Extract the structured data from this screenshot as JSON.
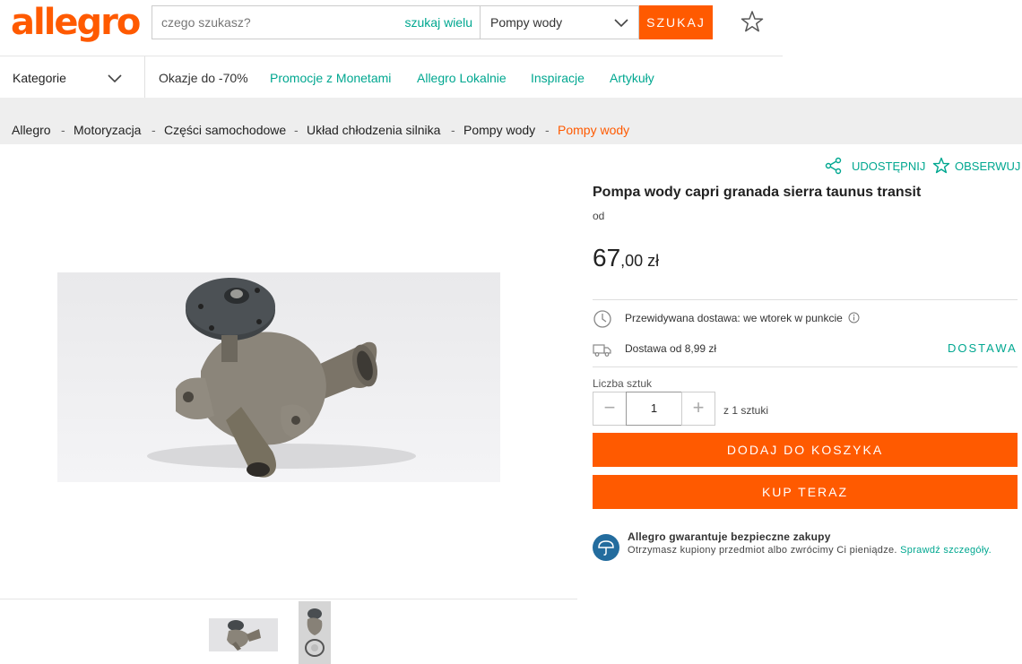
{
  "header": {
    "logo_text": "allegro",
    "search_placeholder": "czego szukasz?",
    "search_many_label": "szukaj wielu",
    "category_selected": "Pompy wody",
    "search_button": "SZUKAJ"
  },
  "nav": {
    "categories_label": "Kategorie",
    "links": [
      "Okazje do -70%",
      "Promocje z Monetami",
      "Allegro Lokalnie",
      "Inspiracje",
      "Artykuły"
    ]
  },
  "breadcrumb": [
    "Allegro",
    "Motoryzacja",
    "Części samochodowe",
    "Układ chłodzenia silnika",
    "Pompy wody",
    "Pompy wody"
  ],
  "breadcrumb_separator": "-",
  "product": {
    "share_label": "UDOSTĘPNIJ",
    "watch_label": "OBSERWUJ",
    "title": "Pompa wody capri granada sierra taunus transit",
    "seller_prefix": "od",
    "price_main": "67",
    "price_frac": ",00 zł",
    "delivery_estimate": "Przewidywana dostawa: we wtorek w punkcie",
    "delivery_cost": "Dostawa od 8,99 zł",
    "delivery_link": "DOSTAWA",
    "quantity_label": "Liczba sztuk",
    "quantity_minus": "−",
    "quantity_value": "1",
    "quantity_plus": "+",
    "quantity_of": "z 1 sztuki",
    "add_to_cart": "DODAJ DO KOSZYKA",
    "buy_now": "KUP TERAZ",
    "guarantee_title": "Allegro gwarantuje bezpieczne zakupy",
    "guarantee_text": "Otrzymasz kupiony przedmiot albo zwrócimy Ci pieniądze.",
    "guarantee_link": "Sprawdź szczegóły."
  },
  "colors": {
    "brand_orange": "#ff5a00",
    "link_teal": "#00a790",
    "guarantee_blue": "#236c9e"
  }
}
